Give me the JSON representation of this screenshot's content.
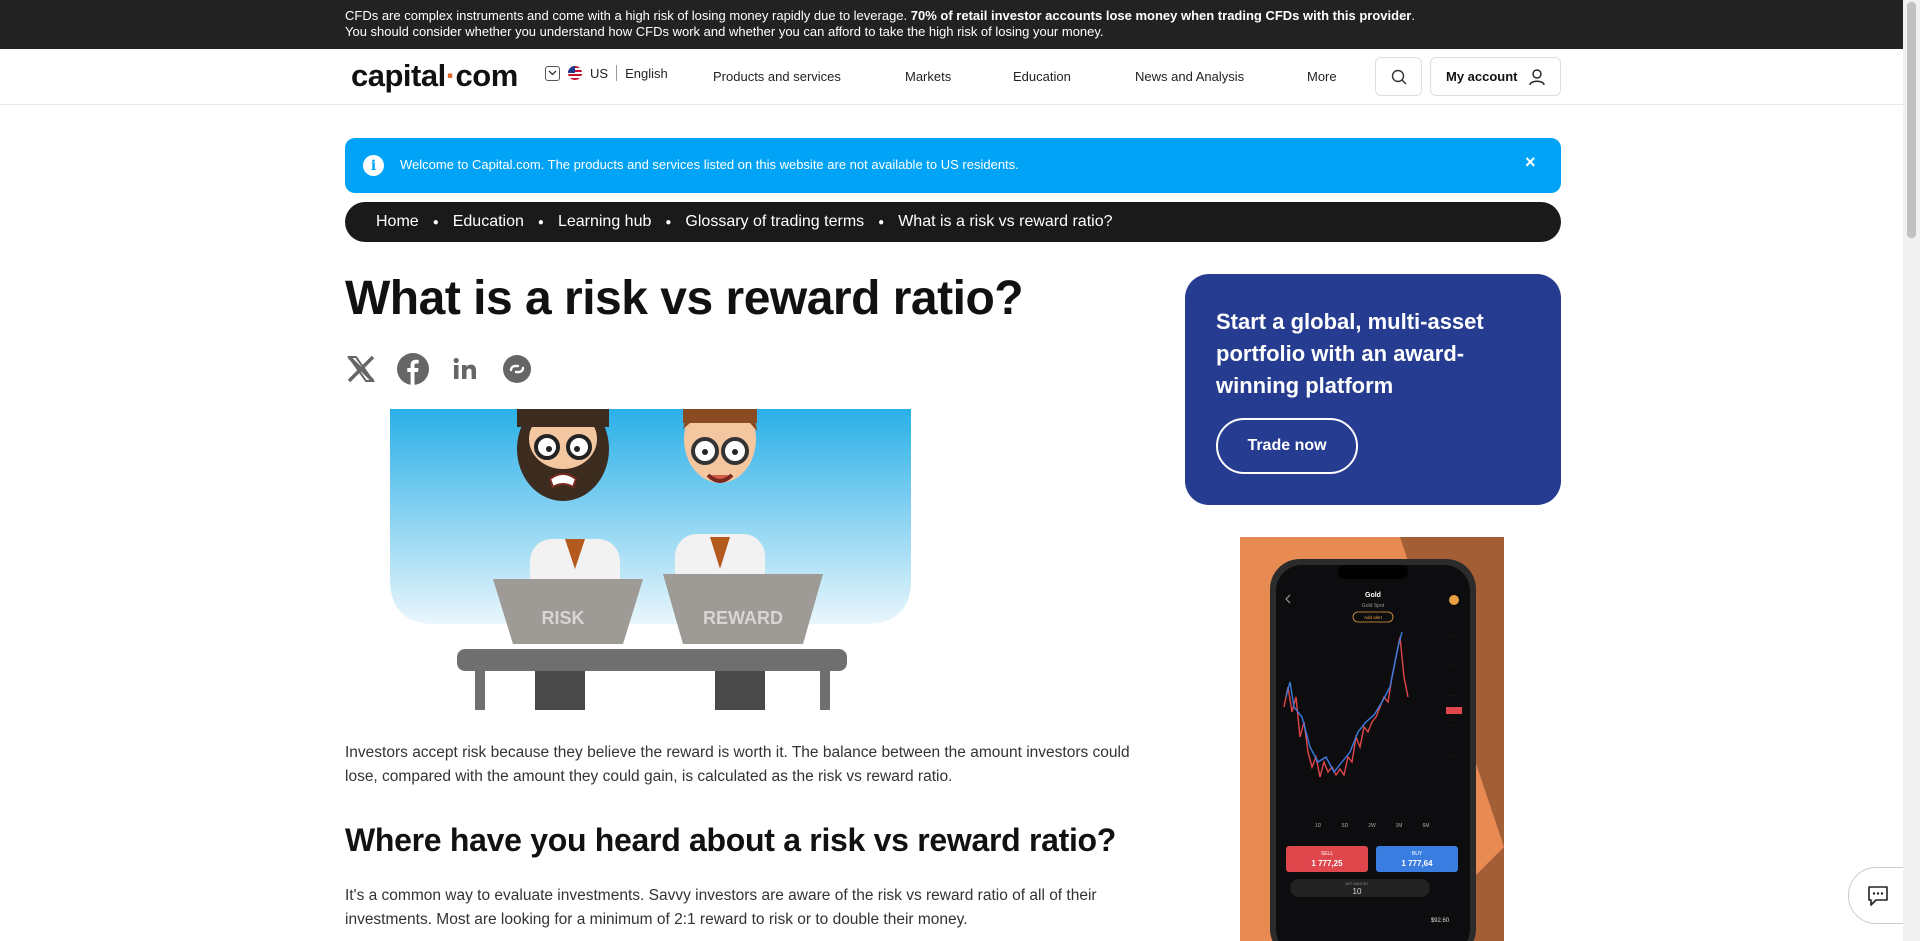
{
  "risk_warning": {
    "text_start": "CFDs are complex instruments and come with a high risk of losing money rapidly due to leverage. ",
    "text_bold": "70% of retail investor accounts lose money when trading CFDs with this provider",
    "text_end": ". You should consider whether you understand how CFDs work and whether you can afford to take the high risk of losing your money."
  },
  "header": {
    "logo_part1": "capital",
    "logo_dot": "·",
    "logo_part2": "com",
    "region": "US",
    "language": "English",
    "nav": [
      "Products and services",
      "Markets",
      "Education",
      "News and Analysis",
      "More"
    ],
    "account_label": "My account",
    "icons": {
      "search": "search-icon",
      "account": "user-icon",
      "region": "chevron-down-icon"
    }
  },
  "notice": {
    "message": "Welcome to Capital.com. The products and services listed on this website are not available to US residents.",
    "close": "×"
  },
  "breadcrumb": [
    "Home",
    "Education",
    "Learning hub",
    "Glossary of trading terms",
    "What is a risk vs reward ratio?"
  ],
  "article": {
    "title": "What is a risk vs reward ratio?",
    "share_icons": [
      "x-icon",
      "facebook-icon",
      "linkedin-icon",
      "copy-link-icon"
    ],
    "hero_labels": {
      "left": "RISK",
      "right": "REWARD"
    },
    "intro": "Investors accept risk because they believe the reward is worth it. The balance between the amount investors could lose, compared with the amount they could gain, is calculated as the risk vs reward ratio.",
    "h2": "Where have you heard about a risk vs reward ratio?",
    "p2": "It's a common way to evaluate investments. Savvy investors are aware of the risk vs reward ratio of all of their investments. Most are looking for a minimum of 2:1 reward to risk or to double their money."
  },
  "sidebar": {
    "promo_text": "Start a global, multi-asset portfolio with an award-winning platform",
    "trade_button": "Trade now",
    "ad": {
      "asset": "Gold",
      "asset_sub": "Gold Spot",
      "alert": "Add alert",
      "timeframes": [
        "1D",
        "5D",
        "2W",
        "1M",
        "6M"
      ],
      "sell_label": "SELL",
      "sell_price": "1 777,25",
      "buy_label": "BUY",
      "buy_price": "1 777,64",
      "amount": "10",
      "amount_label": "NET AMOUNT",
      "margin_value": "$92.60"
    }
  },
  "colors": {
    "accent_blue": "#00a3f5",
    "promo_bg": "#263c91",
    "dark": "#1a1a1a",
    "ad_bg": "#e88b52",
    "sell": "#e0474c",
    "buy": "#3a7de0"
  }
}
